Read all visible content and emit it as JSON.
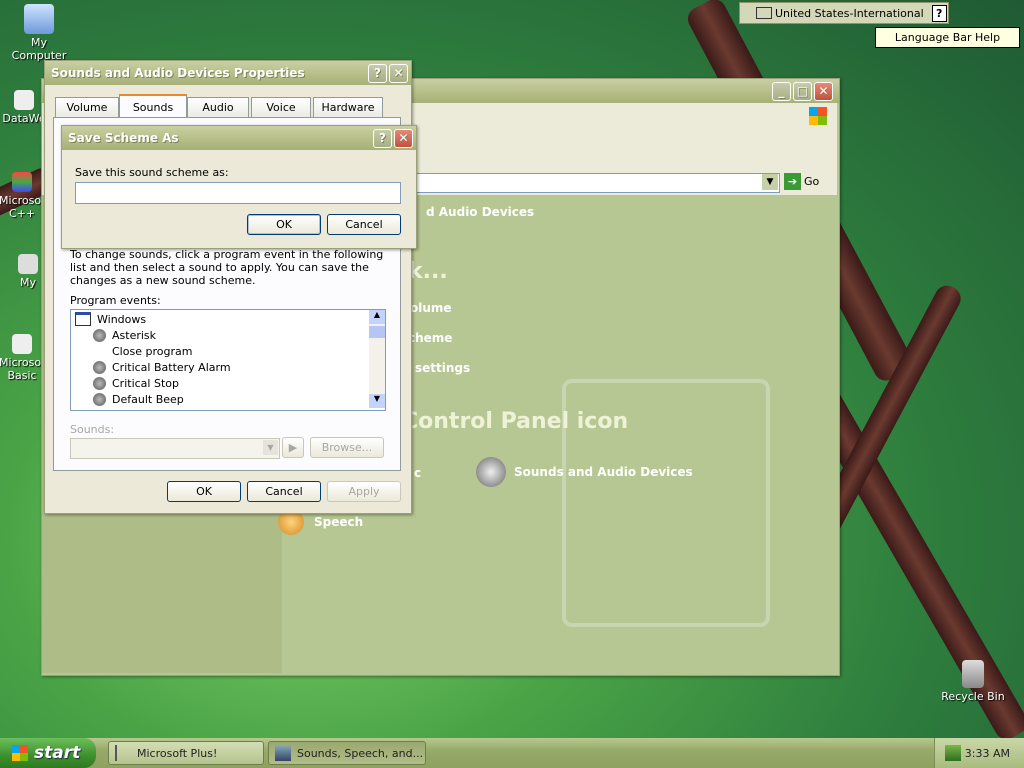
{
  "desktop": {
    "icons": [
      {
        "label": "My Computer"
      },
      {
        "label": "DataWe"
      },
      {
        "label": "Microsof C++"
      },
      {
        "label": "My"
      },
      {
        "label": "Microsof Basic"
      },
      {
        "label": "Recycle Bin"
      }
    ]
  },
  "language_bar": {
    "layout": "United States-International",
    "help_tooltip": "Language Bar Help"
  },
  "control_panel": {
    "go_label": "Go",
    "header_text": "d Audio Devices",
    "pick_text": "k...",
    "tasks": [
      "olume",
      "cheme",
      "settings"
    ],
    "pick_icon_text": "Control Panel icon",
    "items": [
      "c",
      "Sounds and Audio Devices",
      "Speech"
    ]
  },
  "sounds_dialog": {
    "title": "Sounds and Audio Devices Properties",
    "tabs": [
      "Volume",
      "Sounds",
      "Audio",
      "Voice",
      "Hardware"
    ],
    "instructions": "To change sounds, click a program event in the following list and then select a sound to apply. You can save the changes as a new sound scheme.",
    "program_events_label": "Program events:",
    "events": [
      {
        "label": "Windows",
        "type": "group"
      },
      {
        "label": "Asterisk",
        "type": "sound"
      },
      {
        "label": "Close program",
        "type": "none"
      },
      {
        "label": "Critical Battery Alarm",
        "type": "sound"
      },
      {
        "label": "Critical Stop",
        "type": "sound"
      },
      {
        "label": "Default Beep",
        "type": "sound"
      }
    ],
    "sounds_label": "Sounds:",
    "browse_label": "Browse...",
    "ok_label": "OK",
    "cancel_label": "Cancel",
    "apply_label": "Apply"
  },
  "save_scheme_dialog": {
    "title": "Save Scheme As",
    "prompt": "Save this sound scheme as:",
    "input_value": "",
    "ok_label": "OK",
    "cancel_label": "Cancel"
  },
  "taskbar": {
    "start_label": "start",
    "tasks": [
      "Microsoft Plus!",
      "Sounds, Speech, and..."
    ],
    "clock": "3:33 AM"
  }
}
